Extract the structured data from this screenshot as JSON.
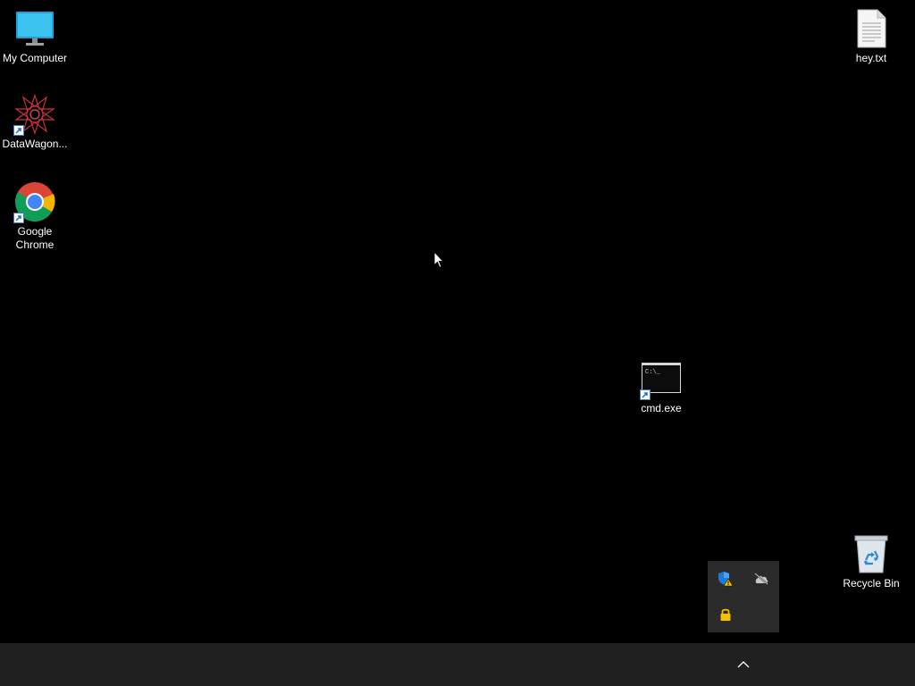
{
  "desktop": {
    "background_color": "#000000",
    "icons": [
      {
        "label": "My Computer",
        "icon": "monitor-icon"
      },
      {
        "label": "DataWagon...",
        "icon": "datawagon-icon",
        "shortcut": true
      },
      {
        "label": "Google Chrome",
        "icon": "chrome-icon",
        "shortcut": true
      },
      {
        "label": "hey.txt",
        "icon": "text-file-icon"
      },
      {
        "label": "cmd.exe",
        "icon": "command-prompt-icon",
        "shortcut": true
      },
      {
        "label": "Recycle Bin",
        "icon": "recycle-bin-icon"
      }
    ]
  },
  "taskbar": {
    "background_color": "#202020",
    "tray_chevron": "chevron-up-icon"
  },
  "tray_popup": {
    "items": [
      {
        "icon": "windows-security-warning-icon"
      },
      {
        "icon": "onedrive-offline-icon"
      },
      {
        "icon": "lock-icon"
      }
    ]
  }
}
